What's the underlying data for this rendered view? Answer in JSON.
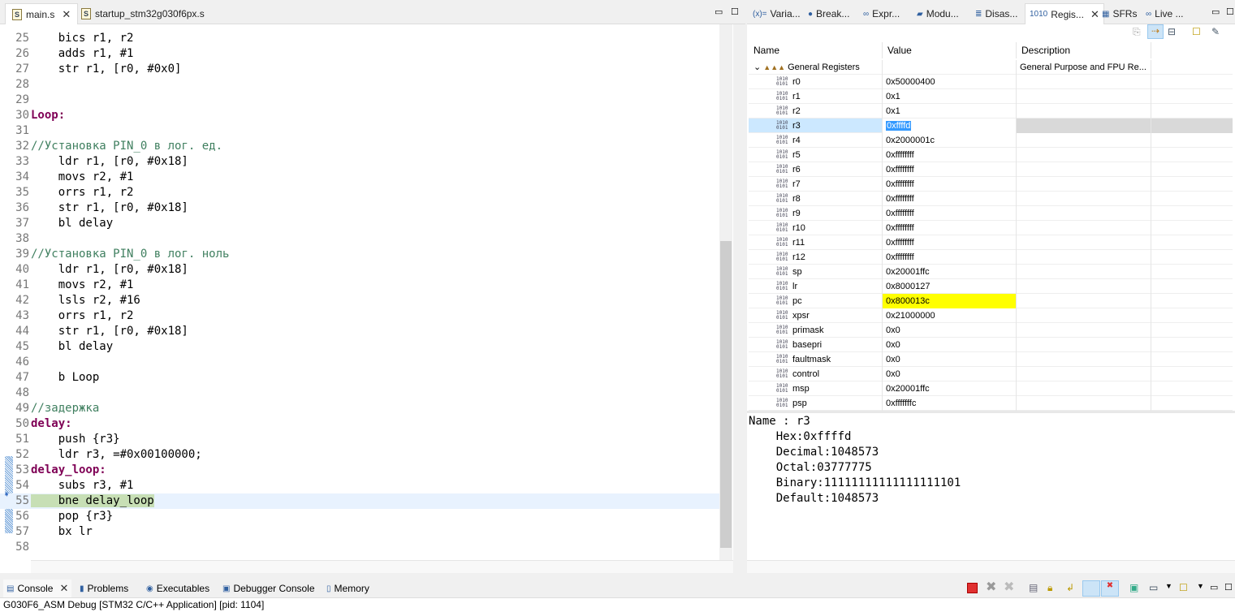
{
  "editor": {
    "tabs": [
      {
        "label": "main.s",
        "active": true,
        "icon": "asm-file-icon"
      },
      {
        "label": "startup_stm32g030f6px.s",
        "active": false,
        "icon": "asm-file-icon"
      }
    ],
    "lines": [
      {
        "n": "25",
        "t": "    bics r1, r2",
        "k": "code"
      },
      {
        "n": "26",
        "t": "    adds r1, #1",
        "k": "code"
      },
      {
        "n": "27",
        "t": "    str r1, [r0, #0x0]",
        "k": "code"
      },
      {
        "n": "28",
        "t": "",
        "k": "code"
      },
      {
        "n": "29",
        "t": "",
        "k": "code"
      },
      {
        "n": "30",
        "t": "Loop:",
        "k": "label"
      },
      {
        "n": "31",
        "t": "",
        "k": "code"
      },
      {
        "n": "32",
        "t": "//Установка PIN_0 в лог. ед.",
        "k": "comment"
      },
      {
        "n": "33",
        "t": "    ldr r1, [r0, #0x18]",
        "k": "code"
      },
      {
        "n": "34",
        "t": "    movs r2, #1",
        "k": "code"
      },
      {
        "n": "35",
        "t": "    orrs r1, r2",
        "k": "code"
      },
      {
        "n": "36",
        "t": "    str r1, [r0, #0x18]",
        "k": "code"
      },
      {
        "n": "37",
        "t": "    bl delay",
        "k": "code"
      },
      {
        "n": "38",
        "t": "",
        "k": "code"
      },
      {
        "n": "39",
        "t": "//Установка PIN_0 в лог. ноль",
        "k": "comment"
      },
      {
        "n": "40",
        "t": "    ldr r1, [r0, #0x18]",
        "k": "code"
      },
      {
        "n": "41",
        "t": "    movs r2, #1",
        "k": "code"
      },
      {
        "n": "42",
        "t": "    lsls r2, #16",
        "k": "code"
      },
      {
        "n": "43",
        "t": "    orrs r1, r2",
        "k": "code"
      },
      {
        "n": "44",
        "t": "    str r1, [r0, #0x18]",
        "k": "code"
      },
      {
        "n": "45",
        "t": "    bl delay",
        "k": "code"
      },
      {
        "n": "46",
        "t": "",
        "k": "code"
      },
      {
        "n": "47",
        "t": "    b Loop",
        "k": "code"
      },
      {
        "n": "48",
        "t": "",
        "k": "code"
      },
      {
        "n": "49",
        "t": "//задержка",
        "k": "comment"
      },
      {
        "n": "50",
        "t": "delay:",
        "k": "label"
      },
      {
        "n": "51",
        "t": "    push {r3}",
        "k": "code"
      },
      {
        "n": "52",
        "t": "    ldr r3, =#0x00100000;",
        "k": "code"
      },
      {
        "n": "53",
        "t": "delay_loop:",
        "k": "label"
      },
      {
        "n": "54",
        "t": "    subs r3, #1",
        "k": "code"
      },
      {
        "n": "55",
        "t": "    bne delay_loop",
        "k": "code",
        "current": true
      },
      {
        "n": "56",
        "t": "    pop {r3}",
        "k": "code"
      },
      {
        "n": "57",
        "t": "    bx lr",
        "k": "code"
      },
      {
        "n": "58",
        "t": "",
        "k": "code"
      }
    ]
  },
  "views": {
    "tabs": [
      {
        "label": "Varia...",
        "icon": "variables-icon"
      },
      {
        "label": "Break...",
        "icon": "breakpoints-icon"
      },
      {
        "label": "Expr...",
        "icon": "expressions-icon"
      },
      {
        "label": "Modu...",
        "icon": "modules-icon"
      },
      {
        "label": "Disas...",
        "icon": "disassembly-icon"
      },
      {
        "label": "Regis...",
        "icon": "registers-icon",
        "active": true
      },
      {
        "label": "SFRs",
        "icon": "sfrs-icon"
      },
      {
        "label": "Live ...",
        "icon": "live-expressions-icon"
      }
    ],
    "columns": [
      "Name",
      "Value",
      "Description"
    ],
    "group": {
      "name": "General Registers",
      "description": "General Purpose and FPU Re..."
    },
    "registers": [
      {
        "name": "r0",
        "value": "0x50000400"
      },
      {
        "name": "r1",
        "value": "0x1"
      },
      {
        "name": "r2",
        "value": "0x1"
      },
      {
        "name": "r3",
        "value": "0xffffd",
        "selected": true
      },
      {
        "name": "r4",
        "value": "0x2000001c"
      },
      {
        "name": "r5",
        "value": "0xffffffff"
      },
      {
        "name": "r6",
        "value": "0xffffffff"
      },
      {
        "name": "r7",
        "value": "0xffffffff"
      },
      {
        "name": "r8",
        "value": "0xffffffff"
      },
      {
        "name": "r9",
        "value": "0xffffffff"
      },
      {
        "name": "r10",
        "value": "0xffffffff"
      },
      {
        "name": "r11",
        "value": "0xffffffff"
      },
      {
        "name": "r12",
        "value": "0xffffffff"
      },
      {
        "name": "sp",
        "value": "0x20001ffc"
      },
      {
        "name": "lr",
        "value": "0x8000127"
      },
      {
        "name": "pc",
        "value": "0x800013c",
        "changed": true
      },
      {
        "name": "xpsr",
        "value": "0x21000000"
      },
      {
        "name": "primask",
        "value": "0x0"
      },
      {
        "name": "basepri",
        "value": "0x0"
      },
      {
        "name": "faultmask",
        "value": "0x0"
      },
      {
        "name": "control",
        "value": "0x0"
      },
      {
        "name": "msp",
        "value": "0x20001ffc"
      },
      {
        "name": "psp",
        "value": "0xfffffffc"
      }
    ],
    "detail": [
      "Name : r3",
      "    Hex:0xffffd",
      "    Decimal:1048573",
      "    Octal:03777775",
      "    Binary:11111111111111111101",
      "    Default:1048573"
    ],
    "highlight_color": "#ffff00"
  },
  "bottom": {
    "tabs": [
      {
        "label": "Console",
        "active": true,
        "icon": "console-icon"
      },
      {
        "label": "Problems",
        "icon": "problems-icon"
      },
      {
        "label": "Executables",
        "icon": "executables-icon"
      },
      {
        "label": "Debugger Console",
        "icon": "debugger-console-icon"
      },
      {
        "label": "Memory",
        "icon": "memory-icon"
      }
    ],
    "status": "G030F6_ASM Debug [STM32 C/C++ Application]  [pid: 1104]"
  }
}
